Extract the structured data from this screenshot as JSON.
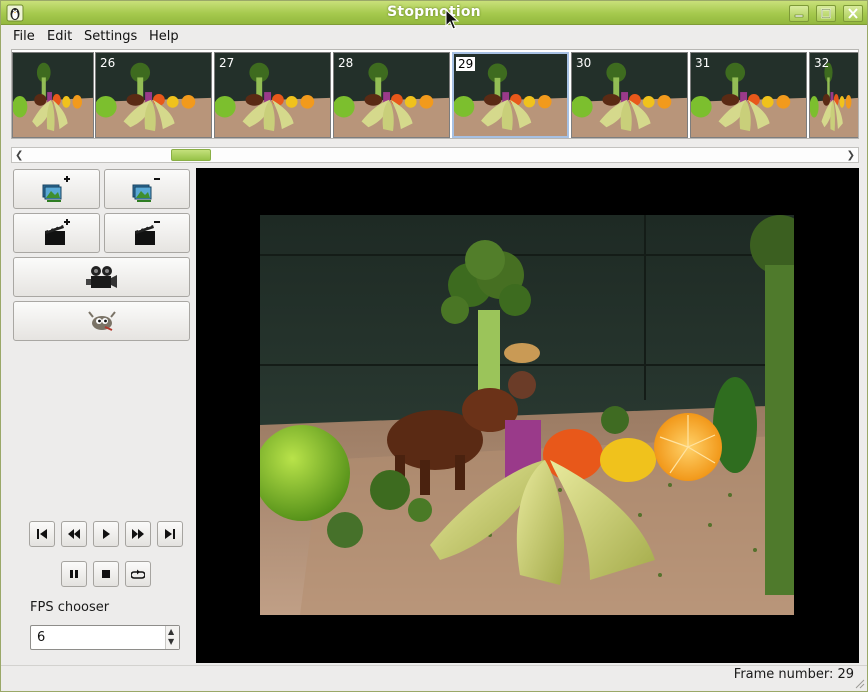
{
  "window": {
    "title": "Stopmotion"
  },
  "menu": {
    "file": "File",
    "edit": "Edit",
    "settings": "Settings",
    "help": "Help"
  },
  "strip": {
    "frames": [
      {
        "label": ""
      },
      {
        "label": "26"
      },
      {
        "label": "27"
      },
      {
        "label": "28"
      },
      {
        "label": "29"
      },
      {
        "label": "30"
      },
      {
        "label": "31"
      },
      {
        "label": "32"
      }
    ],
    "selected_frame": "29"
  },
  "tools": {
    "add_frames_icon": "add-frames-icon",
    "remove_frames_icon": "remove-frames-icon",
    "new_scene_icon": "new-scene-icon",
    "remove_scene_icon": "remove-scene-icon",
    "camera_icon": "video-camera-icon",
    "gimp_icon": "gimp-icon"
  },
  "playback": {
    "buttons": [
      "first-frame-icon",
      "previous-frame-icon",
      "play-icon",
      "next-frame-icon",
      "last-frame-icon",
      "pause-icon",
      "stop-icon",
      "loop-icon"
    ]
  },
  "fps": {
    "label": "FPS chooser",
    "value": "6"
  },
  "status": {
    "text": "Frame number: 29"
  }
}
